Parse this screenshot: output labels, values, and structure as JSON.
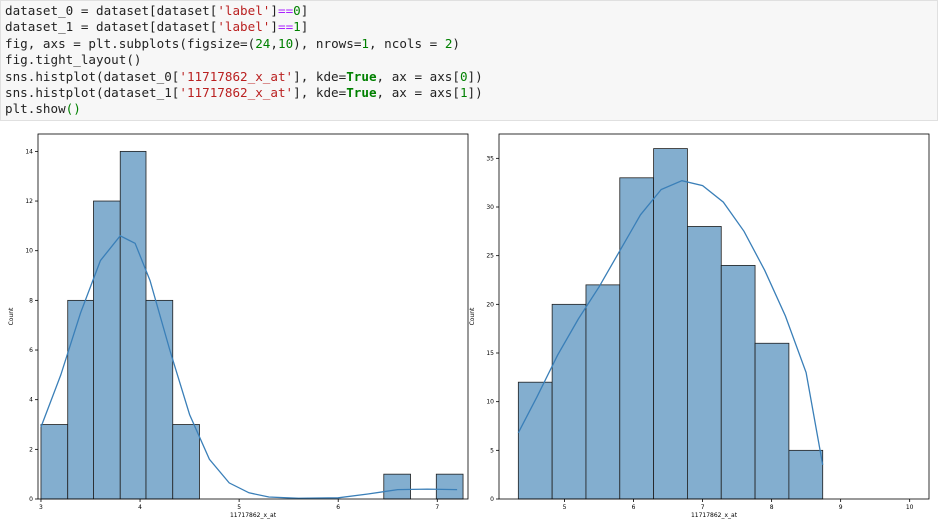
{
  "code_cell": {
    "lines": [
      [
        {
          "t": "dataset_0 = dataset[dataset[",
          "c": ""
        },
        {
          "t": "'label'",
          "c": "str"
        },
        {
          "t": "]",
          "c": ""
        },
        {
          "t": "==",
          "c": "op"
        },
        {
          "t": "0",
          "c": "num"
        },
        {
          "t": "]",
          "c": ""
        }
      ],
      [
        {
          "t": "dataset_1 = dataset[dataset[",
          "c": ""
        },
        {
          "t": "'label'",
          "c": "str"
        },
        {
          "t": "]",
          "c": ""
        },
        {
          "t": "==",
          "c": "op"
        },
        {
          "t": "1",
          "c": "num"
        },
        {
          "t": "]",
          "c": ""
        }
      ],
      [
        {
          "t": "fig, axs = plt.subplots(figsize=(",
          "c": ""
        },
        {
          "t": "24",
          "c": "num"
        },
        {
          "t": ",",
          "c": ""
        },
        {
          "t": "10",
          "c": "num"
        },
        {
          "t": "), nrows=",
          "c": ""
        },
        {
          "t": "1",
          "c": "num"
        },
        {
          "t": ", ncols = ",
          "c": ""
        },
        {
          "t": "2",
          "c": "num"
        },
        {
          "t": ")",
          "c": ""
        }
      ],
      [
        {
          "t": "fig.tight_layout()",
          "c": ""
        }
      ],
      [
        {
          "t": "sns.histplot(dataset_0[",
          "c": ""
        },
        {
          "t": "'11717862_x_at'",
          "c": "str"
        },
        {
          "t": "], kde=",
          "c": ""
        },
        {
          "t": "True",
          "c": "kw"
        },
        {
          "t": ", ax = axs[",
          "c": ""
        },
        {
          "t": "0",
          "c": "num"
        },
        {
          "t": "])",
          "c": ""
        }
      ],
      [
        {
          "t": "sns.histplot(dataset_1[",
          "c": ""
        },
        {
          "t": "'11717862_x_at'",
          "c": "str"
        },
        {
          "t": "], kde=",
          "c": ""
        },
        {
          "t": "True",
          "c": "kw"
        },
        {
          "t": ", ax = axs[",
          "c": ""
        },
        {
          "t": "1",
          "c": "num"
        },
        {
          "t": "])",
          "c": ""
        }
      ],
      [
        {
          "t": "plt.show",
          "c": ""
        },
        {
          "t": "()",
          "c": "num"
        }
      ]
    ]
  },
  "colors": {
    "bar_fill": "#83aecf",
    "bar_edge": "#1f1f1f",
    "kde_line": "#3a7fb8",
    "axis": "#000000"
  },
  "chart_data": [
    {
      "type": "bar",
      "subtype": "histogram-with-kde",
      "xlabel": "11717862_x_at",
      "ylabel": "Count",
      "xlim": [
        2.97,
        7.31
      ],
      "ylim": [
        0,
        14.7
      ],
      "xticks": [
        3,
        4,
        5,
        6,
        7
      ],
      "yticks": [
        0,
        2,
        4,
        6,
        8,
        10,
        12,
        14
      ],
      "bins": [
        {
          "x0": 3.0,
          "x1": 3.27,
          "count": 3
        },
        {
          "x0": 3.27,
          "x1": 3.53,
          "count": 8
        },
        {
          "x0": 3.53,
          "x1": 3.8,
          "count": 12
        },
        {
          "x0": 3.8,
          "x1": 4.06,
          "count": 14
        },
        {
          "x0": 4.06,
          "x1": 4.33,
          "count": 8
        },
        {
          "x0": 4.33,
          "x1": 4.6,
          "count": 3
        },
        {
          "x0": 6.46,
          "x1": 6.73,
          "count": 1
        },
        {
          "x0": 6.99,
          "x1": 7.26,
          "count": 1
        }
      ],
      "kde": [
        [
          3.0,
          2.9
        ],
        [
          3.2,
          5.0
        ],
        [
          3.4,
          7.5
        ],
        [
          3.6,
          9.6
        ],
        [
          3.8,
          10.6
        ],
        [
          3.95,
          10.3
        ],
        [
          4.1,
          8.8
        ],
        [
          4.3,
          6.0
        ],
        [
          4.5,
          3.4
        ],
        [
          4.7,
          1.6
        ],
        [
          4.9,
          0.65
        ],
        [
          5.1,
          0.25
        ],
        [
          5.3,
          0.08
        ],
        [
          5.6,
          0.03
        ],
        [
          6.0,
          0.05
        ],
        [
          6.3,
          0.2
        ],
        [
          6.6,
          0.38
        ],
        [
          6.9,
          0.4
        ],
        [
          7.2,
          0.38
        ]
      ]
    },
    {
      "type": "bar",
      "subtype": "histogram-with-kde",
      "xlabel": "11717862_x_at",
      "ylabel": "Count",
      "xlim": [
        4.05,
        10.28
      ],
      "ylim": [
        0,
        37.5
      ],
      "xticks": [
        5,
        6,
        7,
        8,
        9,
        10
      ],
      "yticks": [
        0,
        5,
        10,
        15,
        20,
        25,
        30,
        35
      ],
      "bins": [
        {
          "x0": 4.33,
          "x1": 4.82,
          "count": 12
        },
        {
          "x0": 4.82,
          "x1": 5.31,
          "count": 20
        },
        {
          "x0": 5.31,
          "x1": 5.8,
          "count": 22
        },
        {
          "x0": 5.8,
          "x1": 6.29,
          "count": 33
        },
        {
          "x0": 6.29,
          "x1": 6.78,
          "count": 36
        },
        {
          "x0": 6.78,
          "x1": 7.27,
          "count": 28
        },
        {
          "x0": 7.27,
          "x1": 7.76,
          "count": 24
        },
        {
          "x0": 7.76,
          "x1": 8.25,
          "count": 16
        },
        {
          "x0": 8.25,
          "x1": 8.74,
          "count": 5
        }
      ],
      "kde": [
        [
          4.33,
          6.8
        ],
        [
          4.6,
          10.5
        ],
        [
          4.9,
          14.8
        ],
        [
          5.2,
          18.5
        ],
        [
          5.5,
          21.8
        ],
        [
          5.8,
          25.5
        ],
        [
          6.1,
          29.2
        ],
        [
          6.4,
          31.8
        ],
        [
          6.7,
          32.7
        ],
        [
          7.0,
          32.2
        ],
        [
          7.3,
          30.5
        ],
        [
          7.6,
          27.5
        ],
        [
          7.9,
          23.5
        ],
        [
          8.2,
          18.8
        ],
        [
          8.5,
          13.0
        ],
        [
          8.74,
          3.5
        ]
      ]
    }
  ]
}
